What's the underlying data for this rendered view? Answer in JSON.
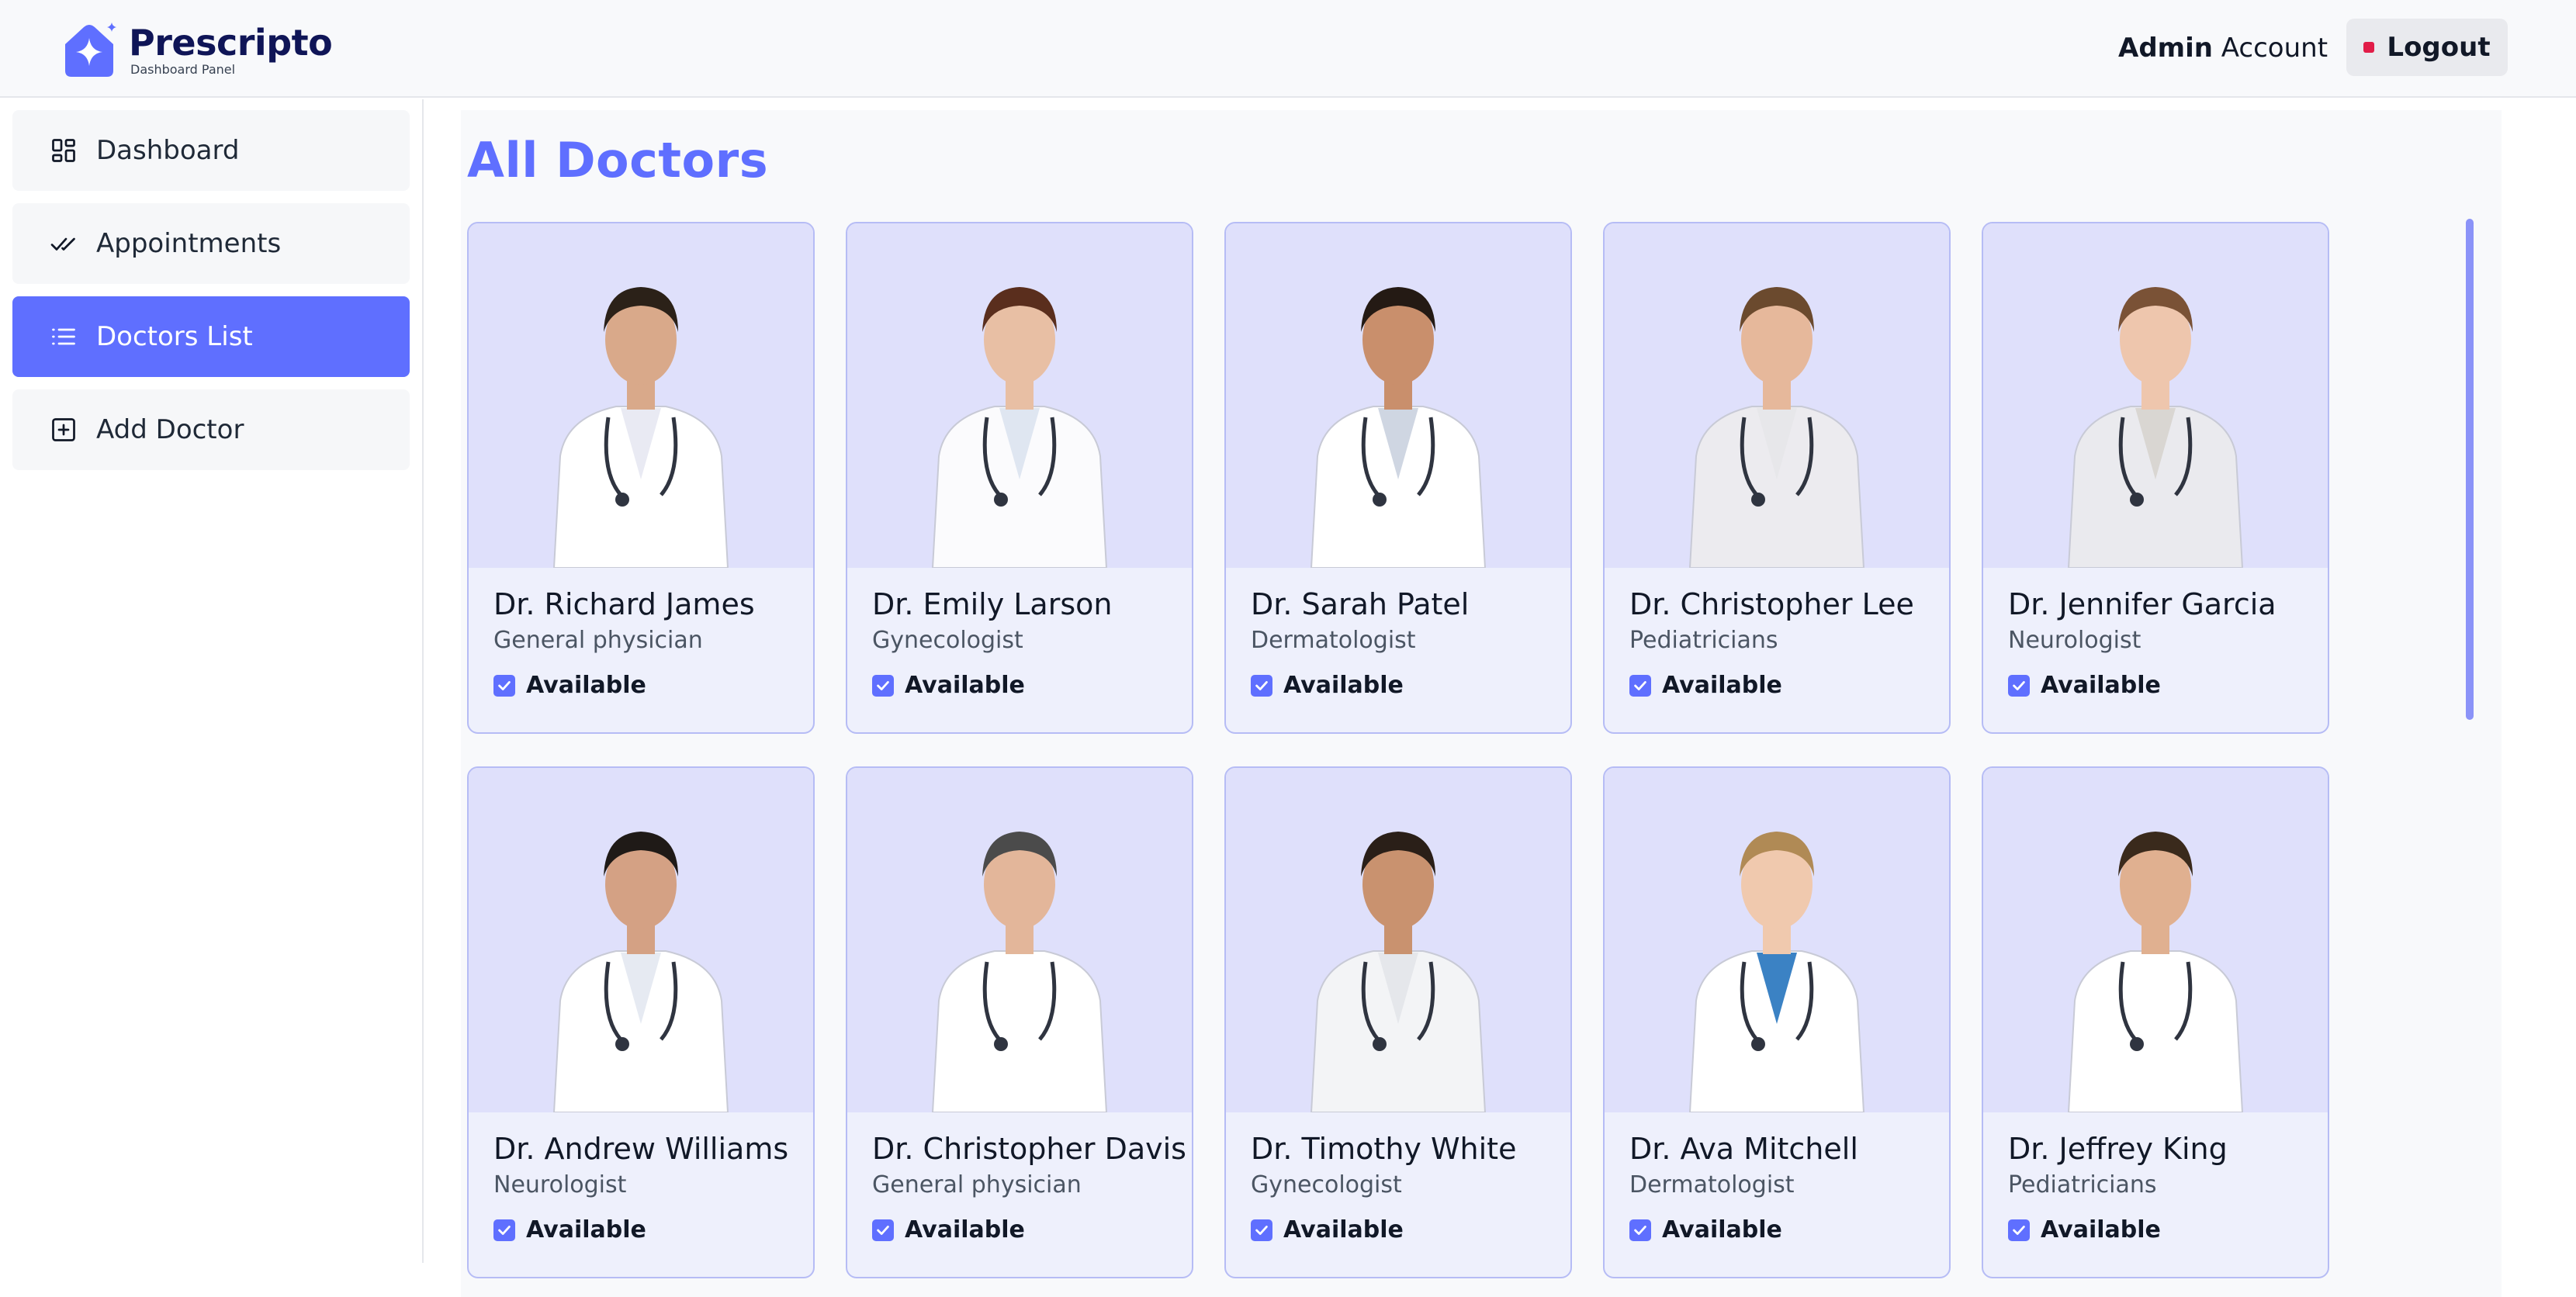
{
  "brand": {
    "name": "Prescripto",
    "subtitle": "Dashboard Panel",
    "accent_color": "#5f6fff",
    "logo_icon": "sparkle-house-icon"
  },
  "header": {
    "account_bold": "Admin",
    "account_rest": " Account",
    "logout_label": "Logout"
  },
  "sidebar": {
    "items": [
      {
        "label": "Dashboard",
        "icon": "dashboard-icon",
        "active": false
      },
      {
        "label": "Appointments",
        "icon": "double-check-icon",
        "active": false
      },
      {
        "label": "Doctors List",
        "icon": "list-icon",
        "active": true
      },
      {
        "label": "Add Doctor",
        "icon": "plus-square-icon",
        "active": false
      }
    ]
  },
  "main": {
    "title": "All Doctors",
    "doctors": [
      {
        "name": "Dr. Richard James",
        "speciality": "General physician",
        "available_label": "Available",
        "available": true
      },
      {
        "name": "Dr. Emily Larson",
        "speciality": "Gynecologist",
        "available_label": "Available",
        "available": true
      },
      {
        "name": "Dr. Sarah Patel",
        "speciality": "Dermatologist",
        "available_label": "Available",
        "available": true
      },
      {
        "name": "Dr. Christopher Lee",
        "speciality": "Pediatricians",
        "available_label": "Available",
        "available": true
      },
      {
        "name": "Dr. Jennifer Garcia",
        "speciality": "Neurologist",
        "available_label": "Available",
        "available": true
      },
      {
        "name": "Dr. Andrew Williams",
        "speciality": "Neurologist",
        "available_label": "Available",
        "available": true
      },
      {
        "name": "Dr. Christopher Davis",
        "speciality": "General physician",
        "available_label": "Available",
        "available": true
      },
      {
        "name": "Dr. Timothy White",
        "speciality": "Gynecologist",
        "available_label": "Available",
        "available": true
      },
      {
        "name": "Dr. Ava Mitchell",
        "speciality": "Dermatologist",
        "available_label": "Available",
        "available": true
      },
      {
        "name": "Dr. Jeffrey King",
        "speciality": "Pediatricians",
        "available_label": "Available",
        "available": true
      }
    ]
  }
}
